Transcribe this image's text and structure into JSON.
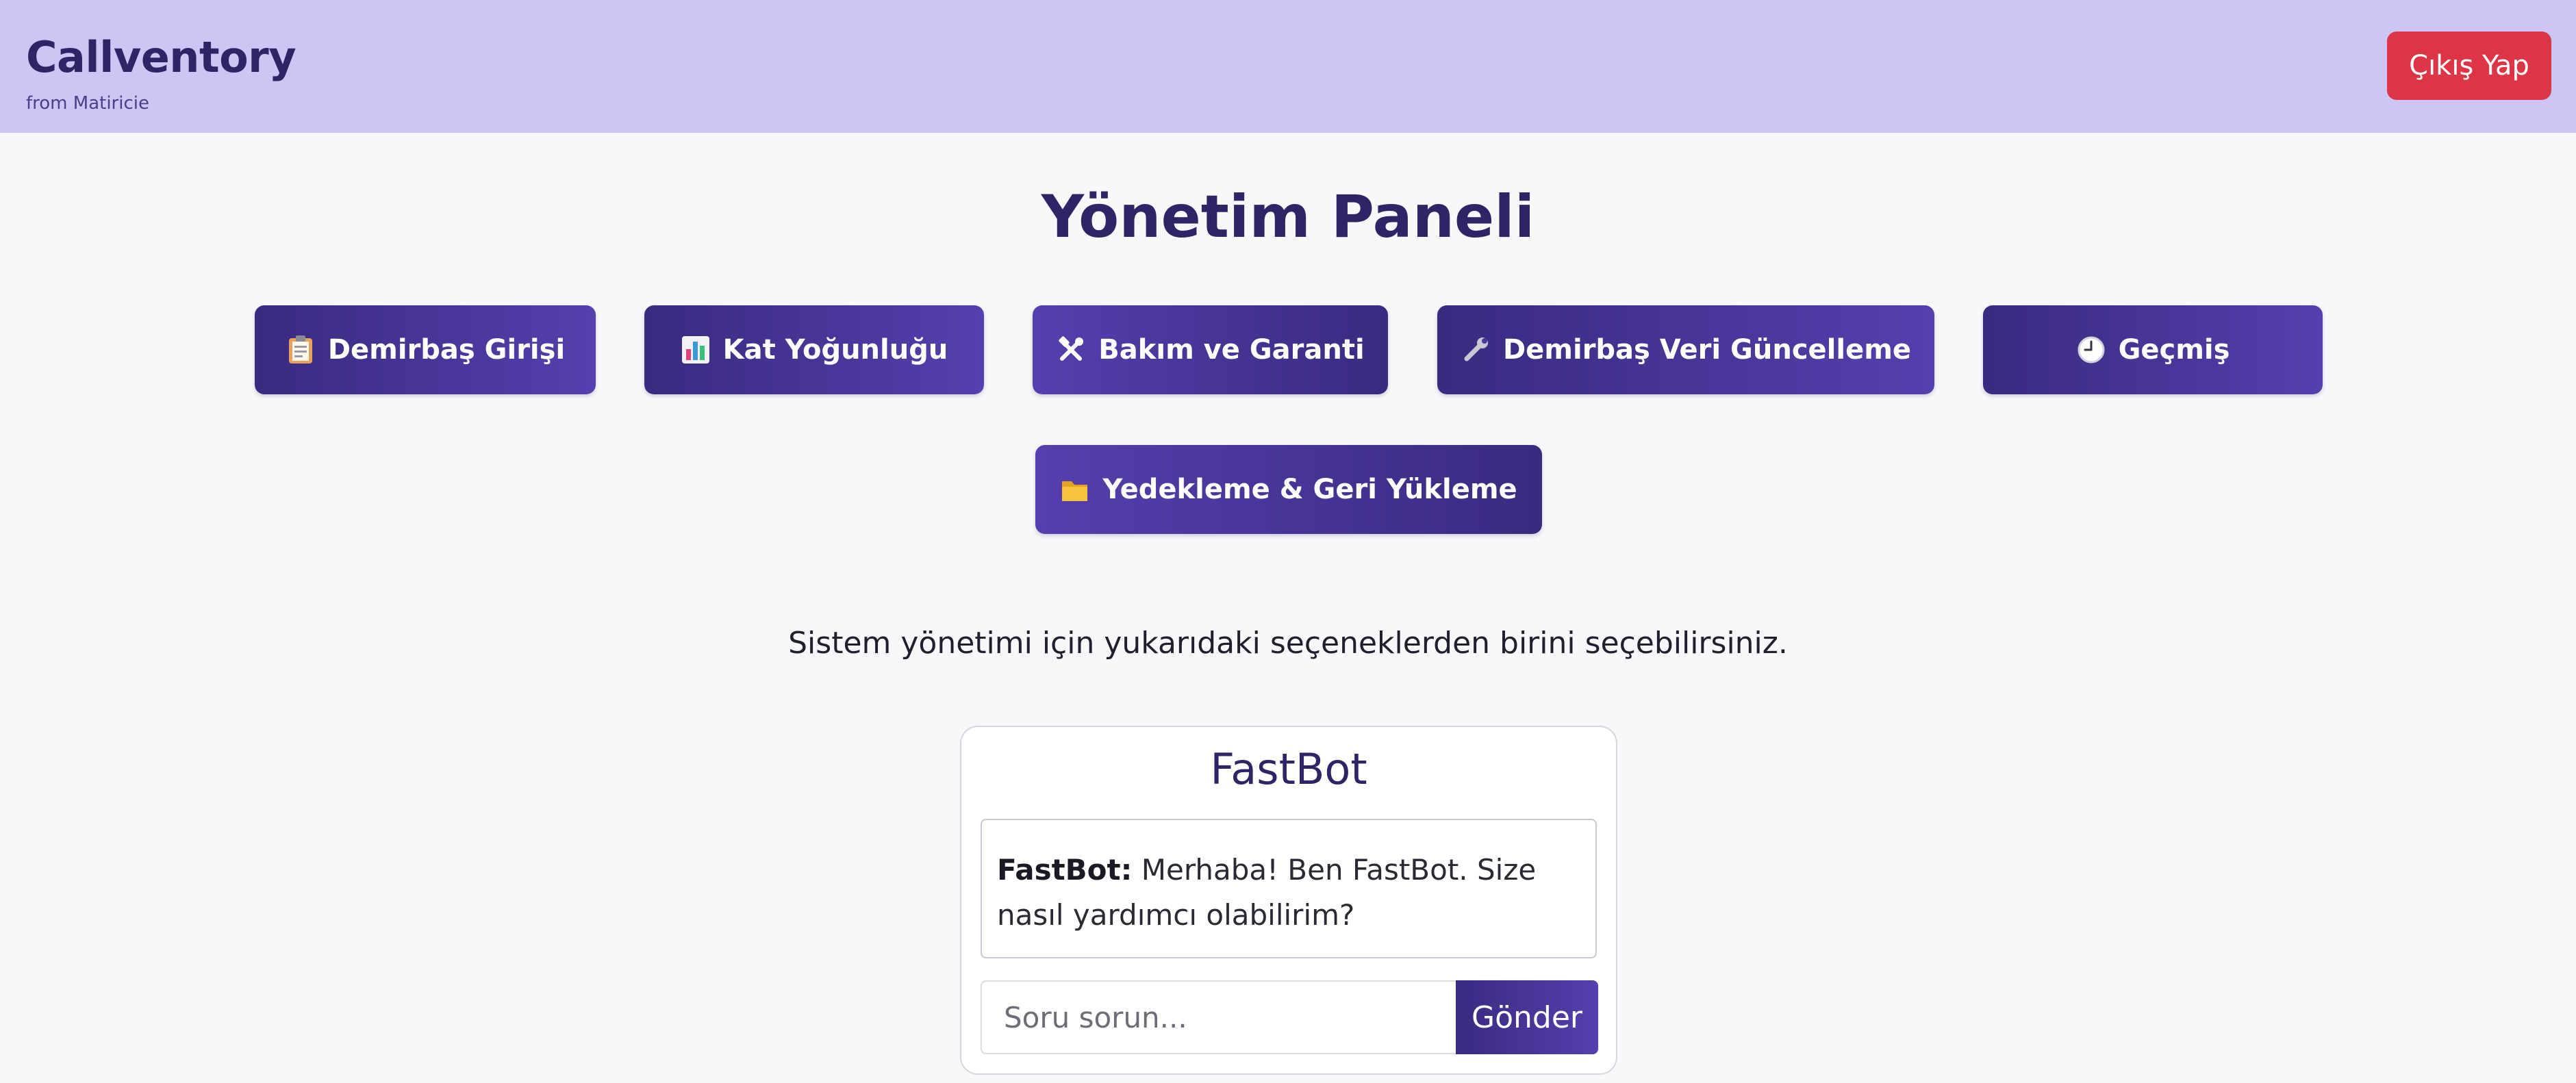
{
  "header": {
    "brand_title": "Callventory",
    "brand_subtitle": "from Matiricie",
    "logout_label": "Çıkış Yap"
  },
  "page": {
    "title": "Yönetim Paneli",
    "info_text": "Sistem yönetimi için yukarıdaki seçeneklerden birini seçebilirsiniz."
  },
  "menu": {
    "items": [
      {
        "label": "Demirbaş Girişi",
        "icon": "clipboard-icon"
      },
      {
        "label": "Kat Yoğunluğu",
        "icon": "bar-chart-icon"
      },
      {
        "label": "Bakım ve Garanti",
        "icon": "hammer-wrench-icon"
      },
      {
        "label": "Demirbaş Veri Güncelleme",
        "icon": "wrench-icon"
      },
      {
        "label": "Geçmiş",
        "icon": "clock-icon"
      },
      {
        "label": "Yedekleme & Geri Yükleme",
        "icon": "folder-icon"
      }
    ]
  },
  "chatbot": {
    "title": "FastBot",
    "messages": [
      {
        "sender": "FastBot:",
        "text": "Merhaba! Ben FastBot. Size nasıl yardımcı olabilirim?"
      }
    ],
    "input_placeholder": "Soru sorun...",
    "input_value": "",
    "send_label": "Gönder"
  },
  "colors": {
    "header_bg": "#cdc6f4",
    "brand": "#2e2466",
    "button_gradient_start": "#3a2a80",
    "button_gradient_end": "#563fae",
    "logout_bg": "#dc3545",
    "page_bg": "#f7f8fa"
  }
}
